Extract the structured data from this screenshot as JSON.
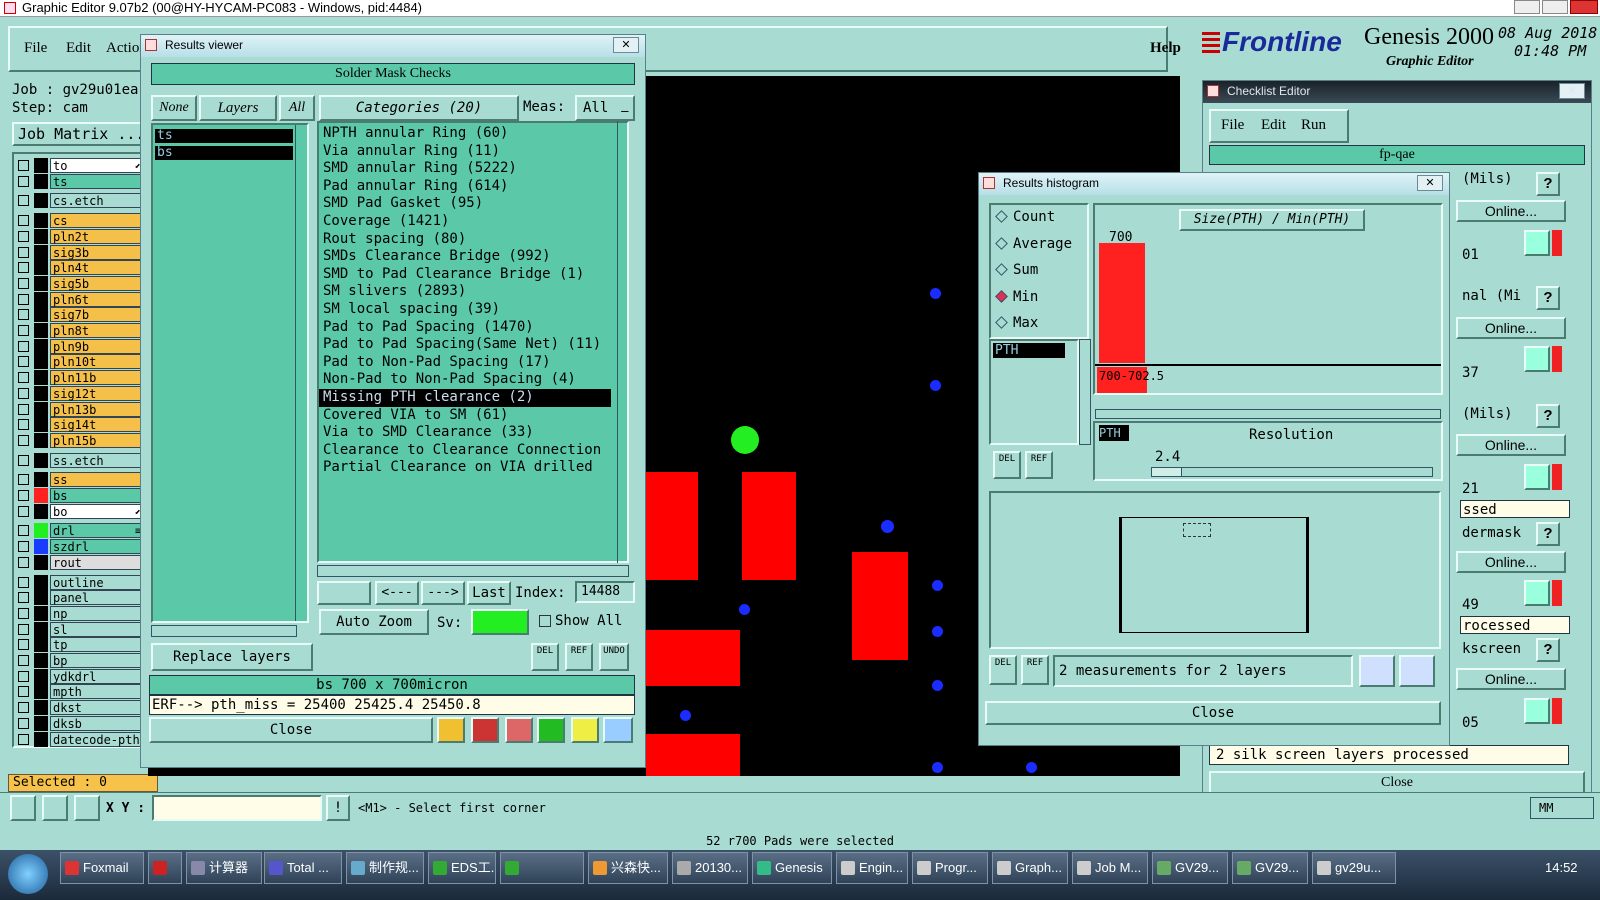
{
  "app": {
    "title": "Graphic Editor 9.07b2 (00@HY-HYCAM-PC083 - Windows, pid:4484)",
    "menu": [
      "File",
      "Edit",
      "Action"
    ],
    "help": "Help",
    "brand": "Frontline",
    "product": "Genesis 2000",
    "subtitle": "Graphic Editor",
    "date": "08 Aug 2018",
    "time": "01:48 PM",
    "job_label": "Job : gv29u01ea",
    "step_label": "Step: cam",
    "job_matrix": "Job Matrix ...",
    "selected": "Selected : 0",
    "xy_label": "X Y :",
    "mouse_hint": "<M1> - Select first corner",
    "status": "52 r700 Pads were selected",
    "mm": "MM"
  },
  "layers": [
    {
      "name": "to",
      "color": "#ffffff",
      "sw": "#000000",
      "mark": "⬋"
    },
    {
      "name": "ts",
      "color": "#5bc9a8",
      "sw": "#000000"
    },
    {
      "name": "cs.etch",
      "color": "#a8dcd2",
      "sw": "#000000",
      "gap": true
    },
    {
      "name": "cs",
      "color": "#f5c04a",
      "sw": "#000000",
      "gap": true
    },
    {
      "name": "pln2t",
      "color": "#f5c04a",
      "sw": "#000000"
    },
    {
      "name": "sig3b",
      "color": "#f5c04a",
      "sw": "#000000"
    },
    {
      "name": "pln4t",
      "color": "#f5c04a",
      "sw": "#000000"
    },
    {
      "name": "sig5b",
      "color": "#f5c04a",
      "sw": "#000000"
    },
    {
      "name": "pln6t",
      "color": "#f5c04a",
      "sw": "#000000"
    },
    {
      "name": "sig7b",
      "color": "#f5c04a",
      "sw": "#000000"
    },
    {
      "name": "pln8t",
      "color": "#f5c04a",
      "sw": "#000000"
    },
    {
      "name": "pln9b",
      "color": "#f5c04a",
      "sw": "#000000"
    },
    {
      "name": "pln10t",
      "color": "#f5c04a",
      "sw": "#000000"
    },
    {
      "name": "pln11b",
      "color": "#f5c04a",
      "sw": "#000000"
    },
    {
      "name": "sig12t",
      "color": "#f5c04a",
      "sw": "#000000"
    },
    {
      "name": "pln13b",
      "color": "#f5c04a",
      "sw": "#000000"
    },
    {
      "name": "sig14t",
      "color": "#f5c04a",
      "sw": "#000000"
    },
    {
      "name": "pln15b",
      "color": "#f5c04a",
      "sw": "#000000"
    },
    {
      "name": "ss.etch",
      "color": "#a8dcd2",
      "sw": "#000000",
      "gap": true
    },
    {
      "name": "ss",
      "color": "#f5c04a",
      "sw": "#000000",
      "gap": true
    },
    {
      "name": "bs",
      "color": "#5bc9a8",
      "sw": "#ff2020"
    },
    {
      "name": "bo",
      "color": "#ffffff",
      "sw": "#000000",
      "mark": "⬋"
    },
    {
      "name": "drl",
      "color": "#5bc9a8",
      "sw": "#22ee22",
      "gap": true,
      "mark": "≡"
    },
    {
      "name": "szdrl",
      "color": "#5bc9a8",
      "sw": "#1a3cff"
    },
    {
      "name": "rout",
      "color": "#dddddd",
      "sw": "#000000"
    },
    {
      "name": "outline",
      "color": "#a8dcd2",
      "sw": "#000000",
      "gap": true
    },
    {
      "name": "panel",
      "color": "#a8dcd2",
      "sw": "#000000"
    },
    {
      "name": "np",
      "color": "#a8dcd2",
      "sw": "#000000"
    },
    {
      "name": "sl",
      "color": "#a8dcd2",
      "sw": "#000000"
    },
    {
      "name": "tp",
      "color": "#a8dcd2",
      "sw": "#000000"
    },
    {
      "name": "bp",
      "color": "#a8dcd2",
      "sw": "#000000"
    },
    {
      "name": "ydkdrl",
      "color": "#a8dcd2",
      "sw": "#000000"
    },
    {
      "name": "mpth",
      "color": "#a8dcd2",
      "sw": "#000000"
    },
    {
      "name": "dkst",
      "color": "#a8dcd2",
      "sw": "#000000"
    },
    {
      "name": "dksb",
      "color": "#a8dcd2",
      "sw": "#000000"
    },
    {
      "name": "datecode-pth",
      "color": "#a8dcd2",
      "sw": "#000000"
    }
  ],
  "results": {
    "title": "Results viewer",
    "header": "Solder Mask Checks",
    "none": "None",
    "layers_btn": "Layers",
    "all": "All",
    "categories_hdr": "Categories (20)",
    "meas_label": "Meas:",
    "meas_value": "All",
    "layer_list": [
      "ts",
      "bs"
    ],
    "categories": [
      "NPTH annular Ring (60)",
      "Via annular Ring (11)",
      "SMD annular Ring (5222)",
      "Pad annular Ring (614)",
      "SMD Pad Gasket (95)",
      "Coverage (1421)",
      "Rout spacing (80)",
      "SMDs Clearance Bridge (992)",
      "SMD to Pad Clearance Bridge (1)",
      "SM slivers (2893)",
      "SM local spacing (39)",
      "Pad to Pad Spacing (1470)",
      "Pad to Pad Spacing(Same Net) (11)",
      "Pad to Non-Pad Spacing (17)",
      "Non-Pad to Non-Pad Spacing (4)",
      "Missing PTH clearance (2)",
      "Covered VIA to SM (61)",
      "Via to SMD Clearance (33)",
      "Clearance to Clearance Connection",
      "Partial Clearance on VIA drilled"
    ],
    "selected_category": 15,
    "prev": "<---",
    "next": "--->",
    "last": "Last",
    "index_label": "Index:",
    "index_value": "14488",
    "auto_zoom": "Auto Zoom",
    "sv_label": "Sv:",
    "show_all": "Show All",
    "replace_layers": "Replace layers",
    "del": "DEL",
    "ref": "REF",
    "undo": "UNDO",
    "info": "bs 700 x 700micron",
    "erf": "ERF--> pth_miss = 25400 25425.4 25450.8",
    "close": "Close"
  },
  "histogram": {
    "title": "Results histogram",
    "options": [
      "Count",
      "Average",
      "Sum",
      "Min",
      "Max"
    ],
    "selected": 3,
    "list": [
      "PTH"
    ],
    "chart_title": "Size(PTH) / Min(PTH)",
    "bar_label": "700",
    "range_label": "700-702.5",
    "pth_label": "PTH",
    "resolution_label": "Resolution",
    "resolution_value": "2.4",
    "measurements": "2 measurements for 2 layers",
    "close": "Close"
  },
  "checklist": {
    "title": "Checklist Editor",
    "menu": [
      "File",
      "Edit",
      "Run"
    ],
    "name": "fp-qae",
    "online": "Online...",
    "q": "?",
    "rows": [
      "(Mils)",
      "01",
      "nal (Mi",
      "37",
      "(Mils)",
      "21",
      "ssed",
      "dermask",
      "49",
      "rocessed",
      "kscreen",
      "05"
    ],
    "footer_text": "2 silk screen layers processed",
    "close": "Close"
  },
  "taskbar": {
    "items": [
      "Foxmail",
      "",
      "计算器",
      "Total ...",
      "制作规...",
      "EDS工...",
      "",
      "兴森快...",
      "20130...",
      "Genesis",
      "Engin...",
      "Progr...",
      "Graph...",
      "Job M...",
      "GV29...",
      "GV29...",
      "gv29u..."
    ],
    "clock": "14:52"
  },
  "chart_data": {
    "type": "bar",
    "title": "Size(PTH) / Min(PTH)",
    "categories": [
      "700-702.5"
    ],
    "values": [
      700
    ],
    "data_labels": [
      "700"
    ]
  }
}
